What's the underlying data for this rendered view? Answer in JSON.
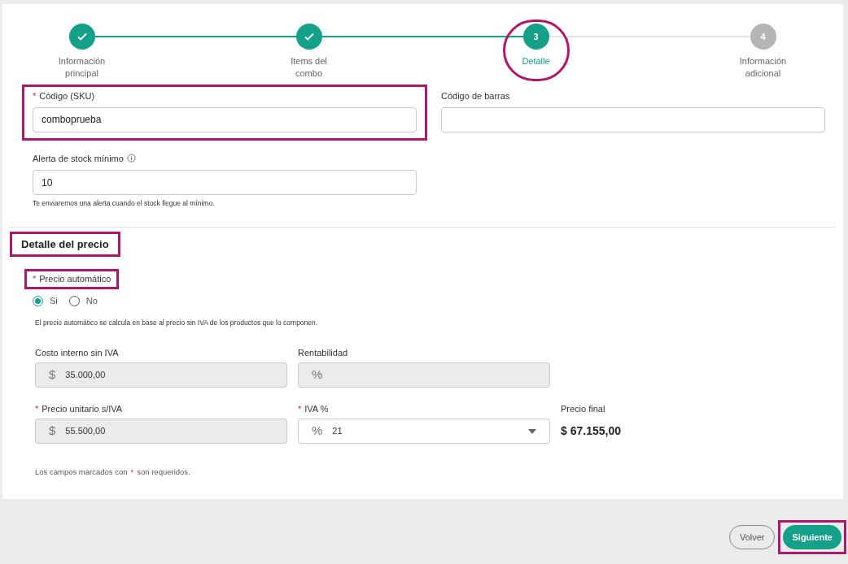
{
  "stepper": [
    {
      "label": "Información principal",
      "kind": "done",
      "highlighted": false
    },
    {
      "label": "Items del combo",
      "kind": "done",
      "highlighted": false
    },
    {
      "label": "Detalle",
      "number": "3",
      "kind": "current",
      "highlighted": true
    },
    {
      "label": "Información adicional",
      "number": "4",
      "kind": "pending",
      "highlighted": false
    }
  ],
  "sku": {
    "label": "Código (SKU)",
    "required": true,
    "value": "comboprueba",
    "highlighted": true
  },
  "barcode": {
    "label": "Código de barras",
    "required": false,
    "highlighted": false
  },
  "stock_alert": {
    "label": "Alerta de stock mínimo",
    "value": "10",
    "help": "Te enviaremos una alerta cuando el stock llegue al mínimo."
  },
  "price_section": {
    "title": "Detalle del precio",
    "highlighted": true
  },
  "auto_price": {
    "label": "Precio automático",
    "required": true,
    "highlighted": true,
    "options": [
      {
        "label": "Si",
        "selected": true
      },
      {
        "label": "No",
        "selected": false
      }
    ],
    "description": "El precio automático se calcula en base al precio sin IVA de los productos que lo componen."
  },
  "price_fields": [
    [
      {
        "kind": "input",
        "label": "Costo interno sin IVA",
        "required": false,
        "prefix": "$",
        "value": "35.000,00",
        "disabled": true
      },
      {
        "kind": "input",
        "label": "Rentabilidad",
        "required": false,
        "prefix": "%",
        "disabled": true
      }
    ],
    [
      {
        "kind": "input",
        "label": "Precio unitario s/IVA",
        "required": true,
        "prefix": "$",
        "value": "55.500,00",
        "disabled": true
      },
      {
        "kind": "select",
        "label": "IVA %",
        "required": true,
        "prefix": "%",
        "value": "21",
        "disabled": false
      },
      {
        "kind": "readout",
        "label": "Precio final",
        "value": "$ 67.155,00"
      }
    ]
  ],
  "required_note": {
    "before": "Los campos marcados con",
    "mark": "*",
    "after": "son requeridos."
  },
  "footer": {
    "back": {
      "label": "Volver",
      "highlighted": false
    },
    "next": {
      "label": "Siguiente",
      "highlighted": true
    }
  }
}
